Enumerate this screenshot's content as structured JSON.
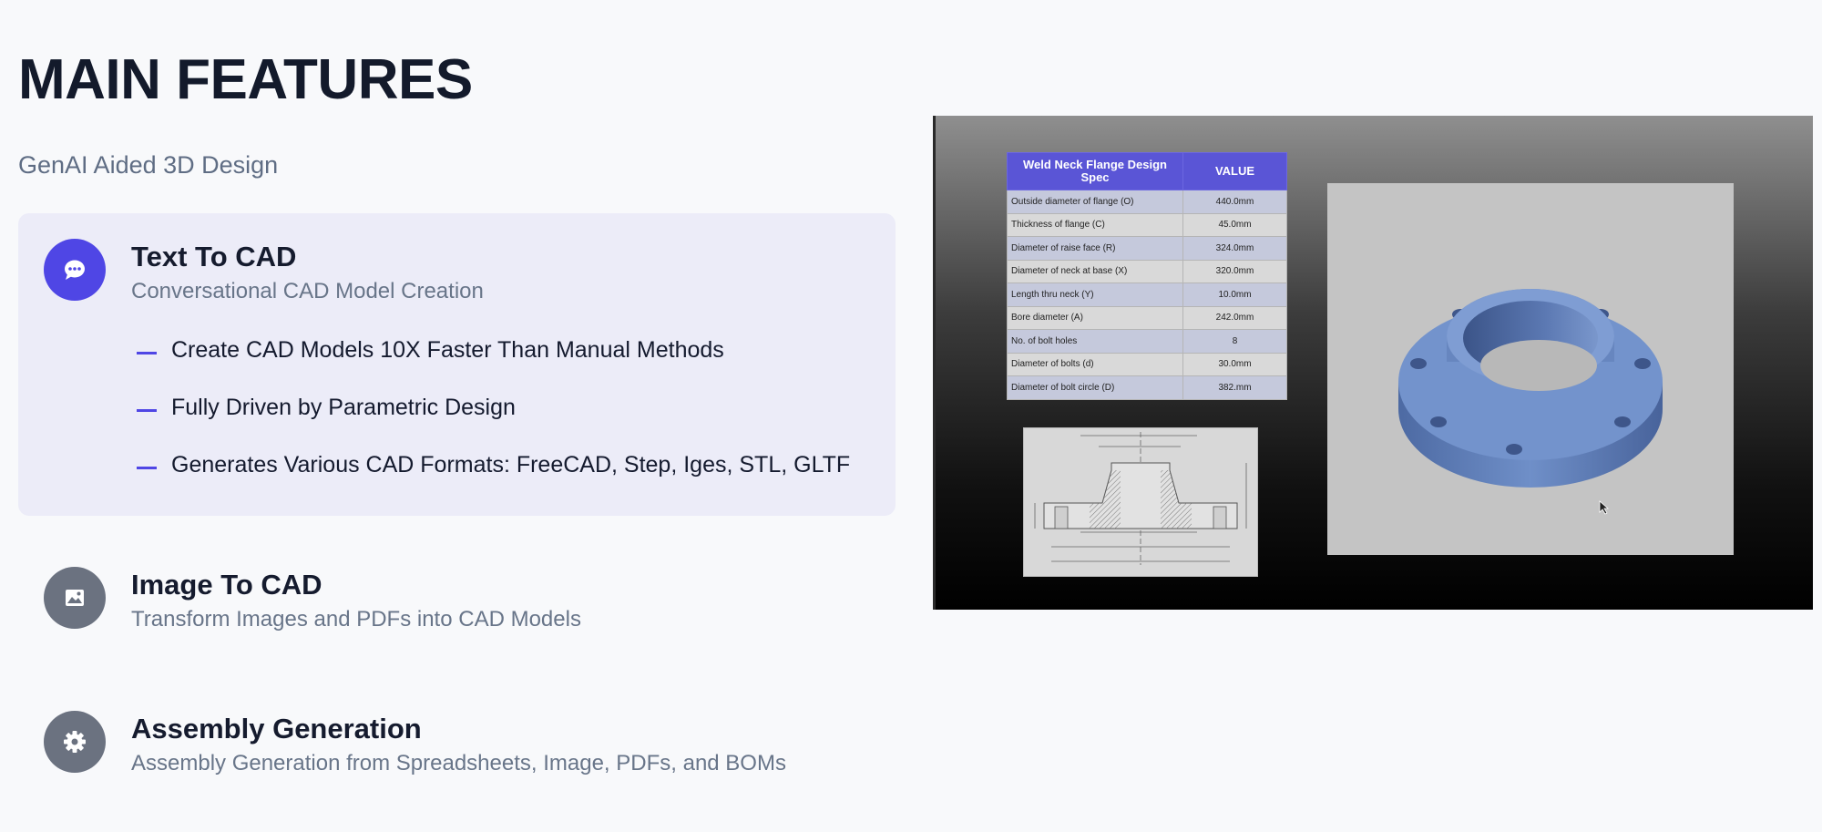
{
  "header": {
    "title": "MAIN FEATURES",
    "subtitle": "GenAI Aided 3D Design"
  },
  "features": [
    {
      "title": "Text To CAD",
      "description": "Conversational CAD Model Creation",
      "icon": "chat-bubble-icon",
      "active": true,
      "bullets": [
        "Create CAD Models 10X Faster Than Manual Methods",
        "Fully Driven by Parametric Design",
        "Generates Various CAD Formats: FreeCAD, Step, Iges, STL, GLTF"
      ]
    },
    {
      "title": "Image To CAD",
      "description": "Transform Images and PDFs into CAD Models",
      "icon": "image-icon",
      "active": false
    },
    {
      "title": "Assembly Generation",
      "description": "Assembly Generation from Spreadsheets, Image, PDFs, and BOMs",
      "icon": "gear-icon",
      "active": false
    }
  ],
  "media": {
    "spec_table": {
      "header_param": "Weld Neck Flange Design Spec",
      "header_value": "VALUE",
      "rows": [
        {
          "param": "Outside diameter of flange (O)",
          "value": "440.0mm"
        },
        {
          "param": "Thickness of flange (C)",
          "value": "45.0mm"
        },
        {
          "param": "Diameter of raise face (R)",
          "value": "324.0mm"
        },
        {
          "param": "Diameter of neck at base (X)",
          "value": "320.0mm"
        },
        {
          "param": "Length thru neck (Y)",
          "value": "10.0mm"
        },
        {
          "param": "Bore diameter (A)",
          "value": "242.0mm"
        },
        {
          "param": "No. of bolt holes",
          "value": "8"
        },
        {
          "param": "Diameter of bolts (d)",
          "value": "30.0mm"
        },
        {
          "param": "Diameter of bolt circle (D)",
          "value": "382.mm"
        }
      ]
    }
  },
  "colors": {
    "accent": "#4f46e5",
    "active_card": "#ececf8",
    "inactive_icon": "#6b7280",
    "flange_blue": "#6b8cc4"
  }
}
